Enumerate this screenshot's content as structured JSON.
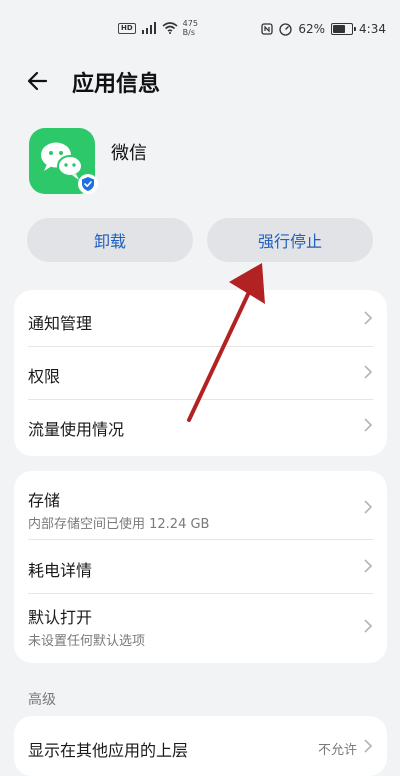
{
  "status_bar": {
    "hd": "HD",
    "net_speed": "475",
    "net_unit": "B/s",
    "battery": "62%",
    "time": "4:34"
  },
  "header": {
    "title": "应用信息"
  },
  "app": {
    "name": "微信"
  },
  "actions": {
    "uninstall": "卸载",
    "force_stop": "强行停止"
  },
  "group1": [
    {
      "label": "通知管理"
    },
    {
      "label": "权限"
    },
    {
      "label": "流量使用情况"
    }
  ],
  "group2": [
    {
      "label": "存储",
      "sub": "内部存储空间已使用 12.24 GB"
    },
    {
      "label": "耗电详情"
    },
    {
      "label": "默认打开",
      "sub": "未设置任何默认选项"
    }
  ],
  "advanced": {
    "section": "高级",
    "overlay_label": "显示在其他应用的上层",
    "overlay_value": "不允许"
  },
  "colors": {
    "accent": "#1e5fbf",
    "wechat_green": "#2dc86a",
    "annotation_arrow": "#b22222"
  },
  "icons": [
    "back-arrow-icon",
    "wechat-icon",
    "verified-shield-icon",
    "chevron-right-icon",
    "signal-icon",
    "wifi-icon",
    "nfc-icon",
    "battery-icon"
  ]
}
